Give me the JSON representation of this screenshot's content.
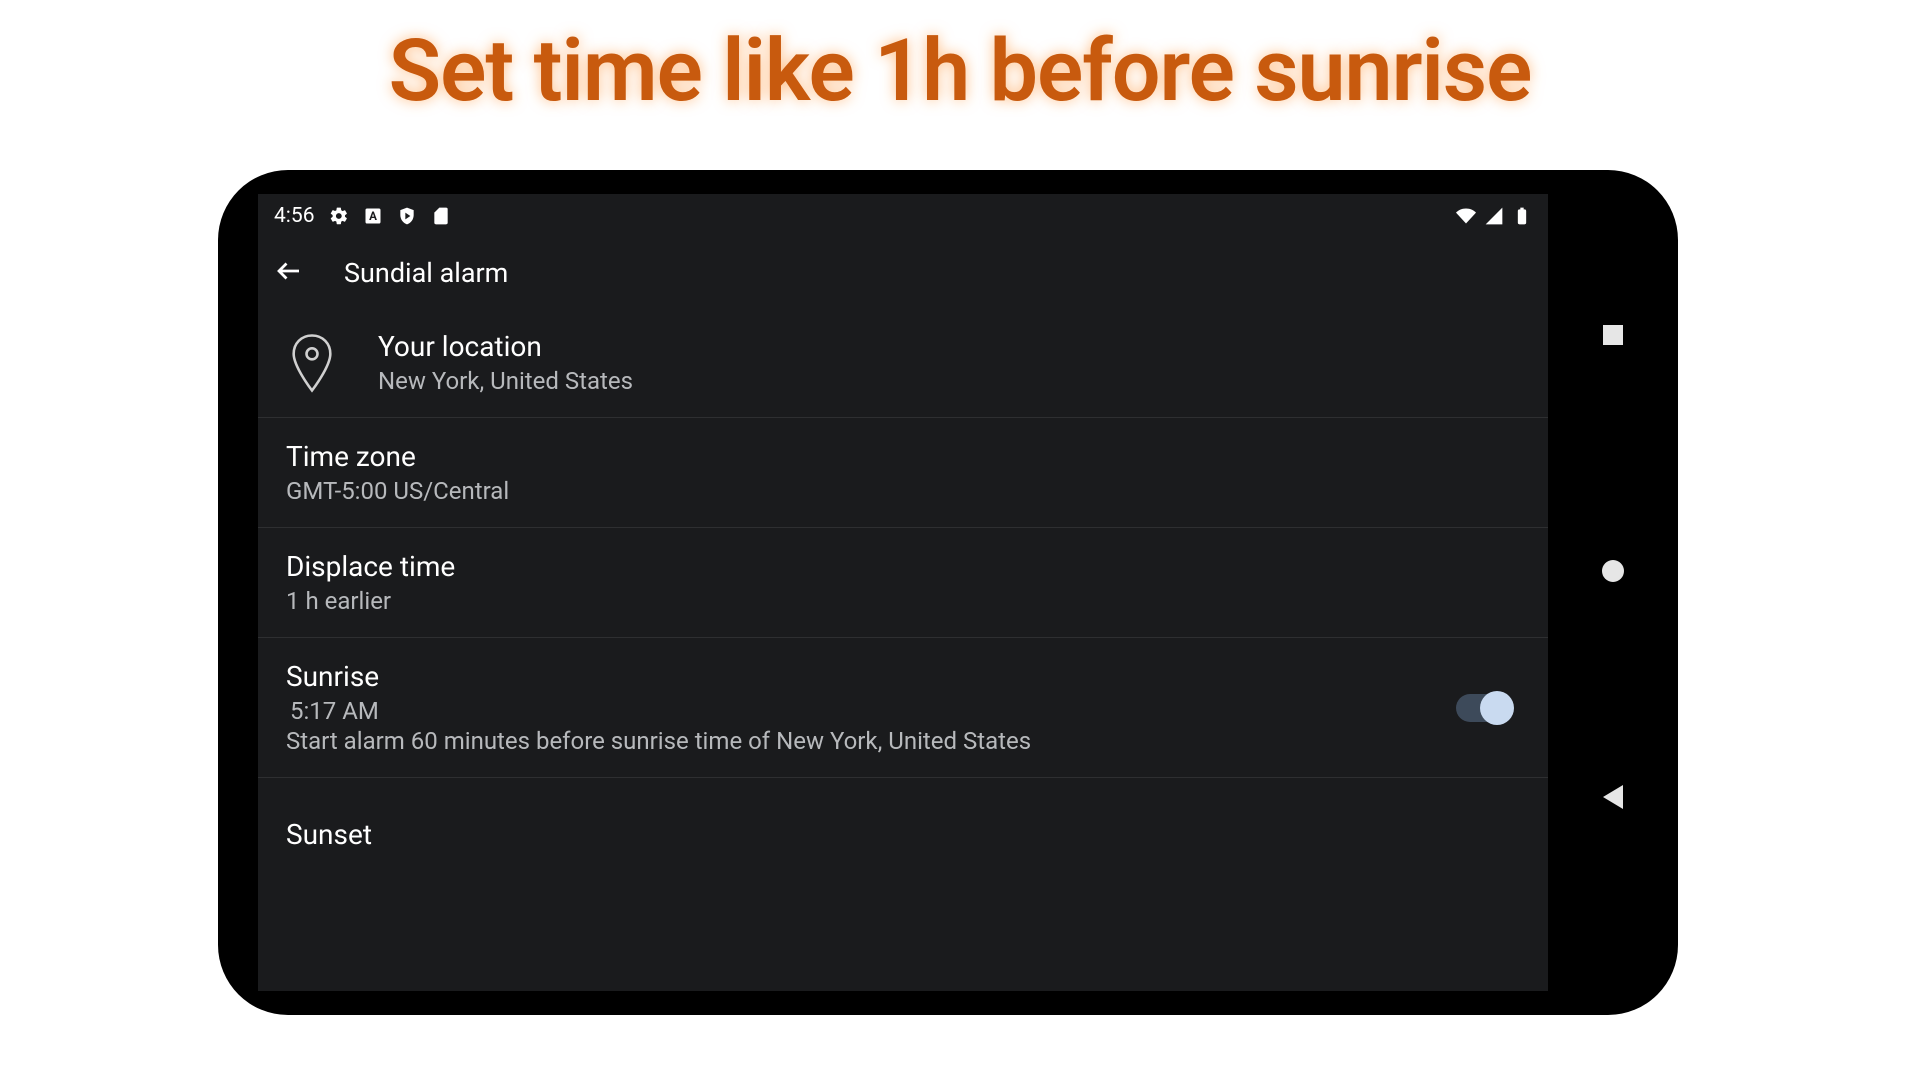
{
  "headline": "Set time like 1h before sunrise",
  "statusbar": {
    "time": "4:56"
  },
  "appbar": {
    "title": "Sundial alarm"
  },
  "rows": {
    "location": {
      "title": "Your location",
      "value": "New York, United States"
    },
    "timezone": {
      "title": "Time zone",
      "value": "GMT-5:00 US/Central"
    },
    "displace": {
      "title": "Displace time",
      "value": "1 h earlier"
    },
    "sunrise": {
      "title": "Sunrise",
      "time": "5:17 AM",
      "desc": "Start alarm 60 minutes before sunrise time of New York, United States",
      "enabled": true
    },
    "sunset": {
      "title": "Sunset"
    }
  }
}
